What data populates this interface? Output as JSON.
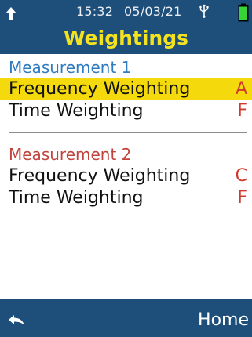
{
  "status_bar": {
    "time": "15:32",
    "date": "05/03/21",
    "left_icon": "up-arrow-icon",
    "usb_icon": "usb-icon",
    "battery_icon": "battery-icon"
  },
  "header": {
    "title": "Weightings"
  },
  "measurement1": {
    "title": "Measurement 1",
    "frequency_label": "Frequency Weighting",
    "frequency_value": "A",
    "time_label": "Time Weighting",
    "time_value": "F"
  },
  "measurement2": {
    "title": "Measurement 2",
    "frequency_label": "Frequency Weighting",
    "frequency_value": "C",
    "time_label": "Time Weighting",
    "time_value": "F"
  },
  "footer": {
    "back_icon": "back-arrow-icon",
    "home_label": "Home"
  },
  "colors": {
    "header_bg": "#1d4f7a",
    "title_yellow": "#f5e21e",
    "selection_yellow": "#f4d90c",
    "measurement1_blue": "#2f7bc0",
    "measurement2_red": "#c0443c",
    "value_red": "#d03a2e",
    "battery_green": "#37d437"
  }
}
